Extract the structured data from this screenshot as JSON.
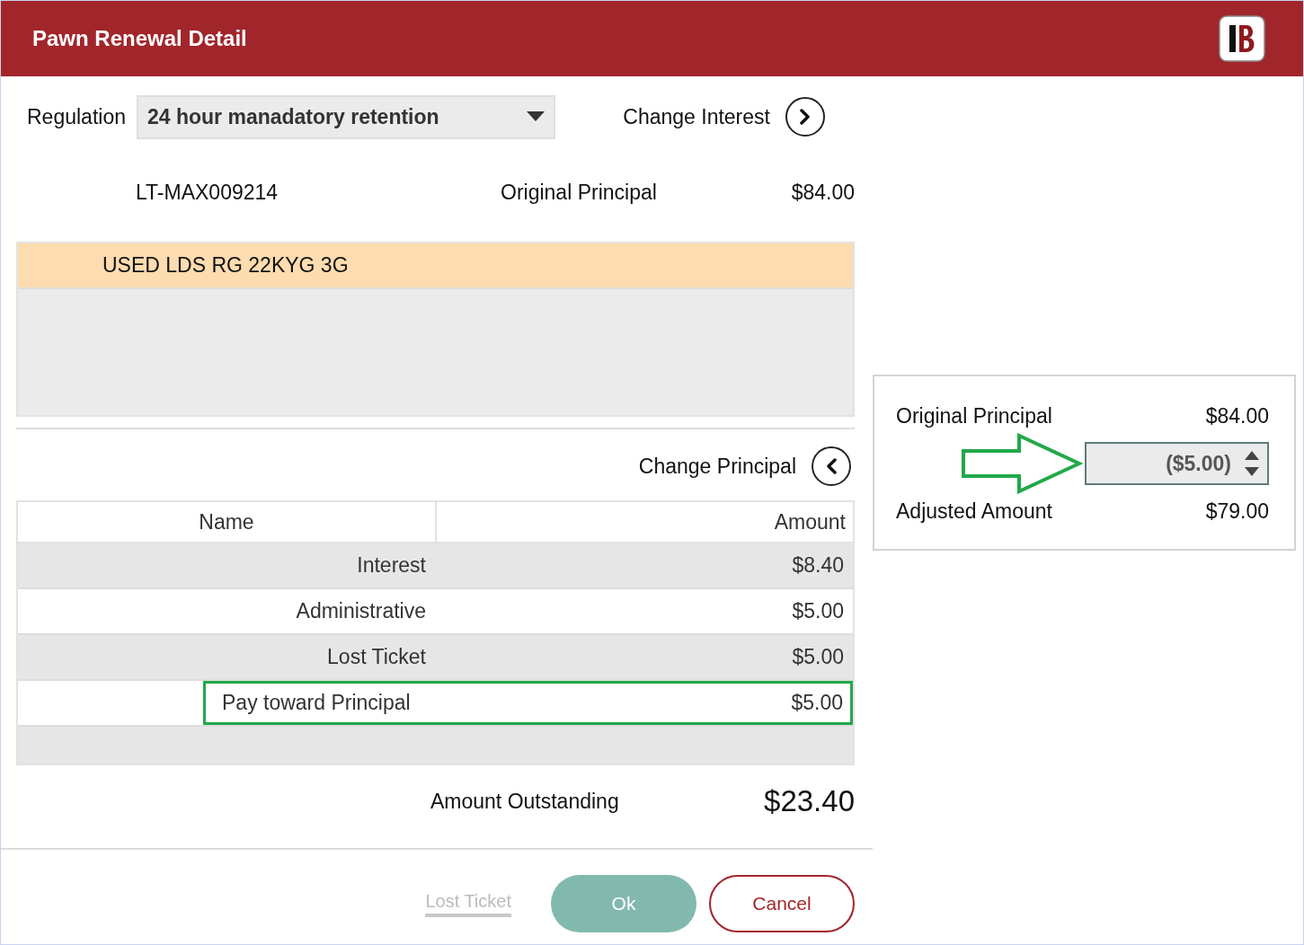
{
  "window": {
    "title": "Pawn Renewal Detail"
  },
  "regulation": {
    "label": "Regulation",
    "value": "24 hour manadatory retention"
  },
  "change_interest": {
    "label": "Change Interest"
  },
  "ticket": {
    "number": "LT-MAX009214",
    "principal_label": "Original Principal",
    "principal_value": "$84.00"
  },
  "items": [
    {
      "text": "USED LDS RG 22KYG 3G",
      "selected": true
    }
  ],
  "change_principal": {
    "label": "Change Principal"
  },
  "fees_table": {
    "columns": [
      "Name",
      "Amount"
    ],
    "rows": [
      {
        "name": "Interest",
        "amount": "$8.40",
        "highlighted": false
      },
      {
        "name": "Administrative",
        "amount": "$5.00",
        "highlighted": false
      },
      {
        "name": "Lost Ticket",
        "amount": "$5.00",
        "highlighted": false
      },
      {
        "name": "Pay toward Principal",
        "amount": "$5.00",
        "highlighted": true
      }
    ]
  },
  "amount_outstanding": {
    "label": "Amount Outstanding",
    "value": "$23.40"
  },
  "buttons": [
    {
      "kind": "link",
      "label": "Lost Ticket",
      "disabled": true
    },
    {
      "kind": "primary",
      "label": "Ok",
      "disabled": false
    },
    {
      "kind": "secondary",
      "label": "Cancel",
      "disabled": false
    }
  ],
  "principal_panel": {
    "original_label": "Original Principal",
    "original_value": "$84.00",
    "adjustment": "($5.00)",
    "adjusted_label": "Adjusted Amount",
    "adjusted_value": "$79.00"
  }
}
